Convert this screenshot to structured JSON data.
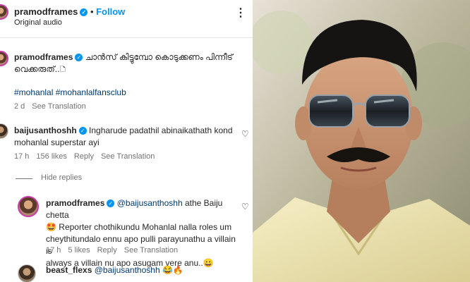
{
  "post": {
    "username": "pramodframes",
    "follow_label": "Follow",
    "audio_label": "Original audio",
    "more_label": "⋮"
  },
  "caption": {
    "username": "pramodframes",
    "text": "ചാൻസ് കിട്ടുമ്പോ കൊടുക്കണം പിന്നീട് വെക്കരുത്..🗅",
    "hashtags": "#mohanlal #mohanlalfansclub",
    "age": "2 d",
    "translation": "See Translation"
  },
  "comment1": {
    "username": "baijusanthoshh",
    "line1": "Ingharude padathil abinaikathath kond",
    "line2": "mohanlal superstar ayi",
    "age": "17 h",
    "likes": "156 likes",
    "reply": "Reply",
    "translation": "See Translation"
  },
  "hide_replies": "Hide replies",
  "reply1": {
    "username": "pramodframes",
    "mention": "@baijusanthoshh",
    "line1_rest": "athe Baiju chetta",
    "line2": "🤩 Reporter chothikundu Mohanlal nalla roles um",
    "line3": "cheythitundalo ennu apo pulli parayunathu a villain is",
    "line4": "always a villain nu apo asugam vere anu..😀",
    "age": "17 h",
    "likes": "5 likes",
    "reply": "Reply",
    "translation": "See Translation"
  },
  "reply2": {
    "username": "beast_flexs",
    "mention": "@baijusanthoshh",
    "emoji": "😂🔥"
  }
}
